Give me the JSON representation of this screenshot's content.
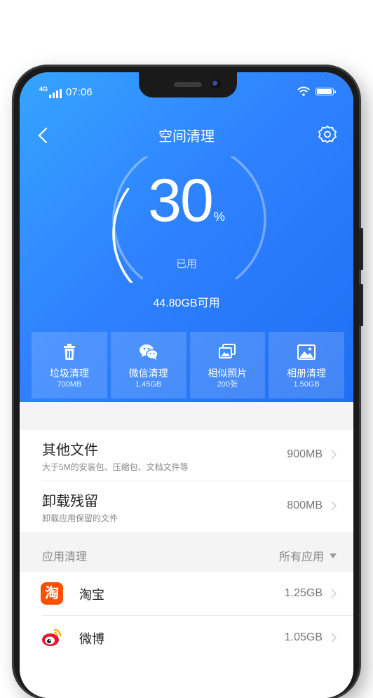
{
  "status": {
    "network": "4G",
    "time": "07:06"
  },
  "header": {
    "title": "空间清理"
  },
  "usage": {
    "percent": "30",
    "unit": "%",
    "used_label": "已用",
    "available": "44.80GB可用",
    "fraction_used": 0.3
  },
  "tiles": [
    {
      "name": "垃圾清理",
      "value": "700MB",
      "icon": "trash-icon"
    },
    {
      "name": "微信清理",
      "value": "1.45GB",
      "icon": "wechat-icon"
    },
    {
      "name": "相似照片",
      "value": "200张",
      "icon": "similar-photos-icon"
    },
    {
      "name": "相册清理",
      "value": "1.50GB",
      "icon": "album-icon"
    }
  ],
  "files": [
    {
      "name": "其他文件",
      "desc": "大于5M的安装包、压缩包、文档文件等",
      "size": "900MB"
    },
    {
      "name": "卸载残留",
      "desc": "卸载应用保留的文件",
      "size": "800MB"
    }
  ],
  "apps_section": {
    "label": "应用清理",
    "filter": "所有应用"
  },
  "apps": [
    {
      "name": "淘宝",
      "size": "1.25GB",
      "icon_char": "淘",
      "icon_color": "#ff5000"
    },
    {
      "name": "微博",
      "size": "1.05GB",
      "icon_color": "#ffb400"
    }
  ],
  "colors": {
    "accent": "#2f82ff",
    "taobao": "#ff5000",
    "weibo_red": "#e6162d"
  }
}
